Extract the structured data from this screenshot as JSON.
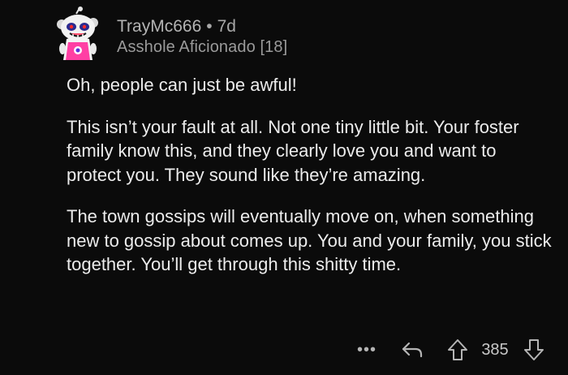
{
  "comment": {
    "author": "TrayMc666",
    "separator": "•",
    "age": "7d",
    "flair": "Asshole Aficionado [18]",
    "paragraphs": [
      "Oh, people can just be awful!",
      "This isn’t your fault at all. Not one tiny little bit. Your foster family know this, and they clearly love you and want to protect you. They sound like they’re amazing.",
      "The town gossips will eventually move on, when something new to gossip about comes up. You and your family, you stick together. You’ll get through this shitty time."
    ]
  },
  "actions": {
    "more_label": "•••",
    "score": "385"
  },
  "icons": {
    "avatar": "snoo-avatar-icon",
    "more": "more-options-icon",
    "reply": "reply-arrow-icon",
    "upvote": "upvote-arrow-icon",
    "downvote": "downvote-arrow-icon"
  },
  "colors": {
    "background": "#0b0b0b",
    "text": "#ececec",
    "meta_text": "#a8a8a8"
  }
}
